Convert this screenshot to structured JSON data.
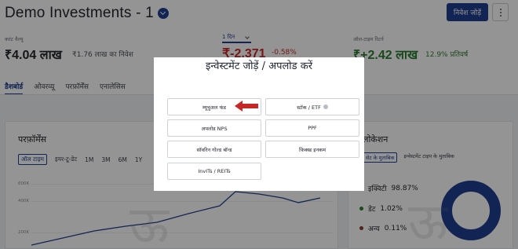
{
  "header": {
    "title": "Demo Investments - 1",
    "add_button": "निवेश जोड़ें"
  },
  "stats": {
    "current_value_label": "करंट वैल्यू",
    "current_value": "₹4.04 लाख",
    "invested": "₹1.76 लाख का निवेश",
    "period": "1 दिन",
    "day_change": "₹-2,371",
    "day_change_pct": "-0.58%",
    "all_time_label": "ऑल-टाइम रिटर्न",
    "all_time_return": "₹+2.42 लाख",
    "all_time_pct": "12.9% प्रतिवर्ष"
  },
  "tabs": [
    "डैशबोर्ड",
    "ओवरव्यू",
    "परफ़ॉर्मेंस",
    "एनालेसिस"
  ],
  "performance": {
    "title": "परफ़ॉर्मेंस",
    "ranges": [
      "ऑल टाइम",
      "इयर-टू-डेट",
      "1M",
      "3M",
      "6M",
      "1Y"
    ],
    "ytick_labels": [
      "600K",
      "400K",
      "200K"
    ]
  },
  "allocation": {
    "title": "लोकेशन",
    "tabs": [
      "सेट के मुताबिक",
      "इन्वेस्टमेंट टाइप के मुताबिक"
    ],
    "legend": [
      {
        "label": "इक्विटी",
        "value": "98.87%",
        "color": "#1f3f8f"
      },
      {
        "label": "डेट",
        "value": "1.02%",
        "color": "#2e7d32"
      },
      {
        "label": "अन्य",
        "value": "0.11%",
        "color": "#8a3b2a"
      }
    ]
  },
  "modal": {
    "title": "इन्वेस्टमेंट जोड़ें / अपलोड करें",
    "options": {
      "mutual_fund": "म्यूचुअल फंड",
      "stock_etf": "स्टॉक / ETF",
      "upload_nps": "अपलोड NPS",
      "ppf": "PPF",
      "sgb": "सॉवरिन गोल्ड बॉन्ड",
      "fd": "फ़िक्स्ड इनकम",
      "invits": "InvITs / REITs"
    }
  },
  "colors": {
    "brand": "#1f3f8f",
    "negative": "#c62828",
    "positive": "#2e7d32",
    "arrow": "#c62828"
  }
}
